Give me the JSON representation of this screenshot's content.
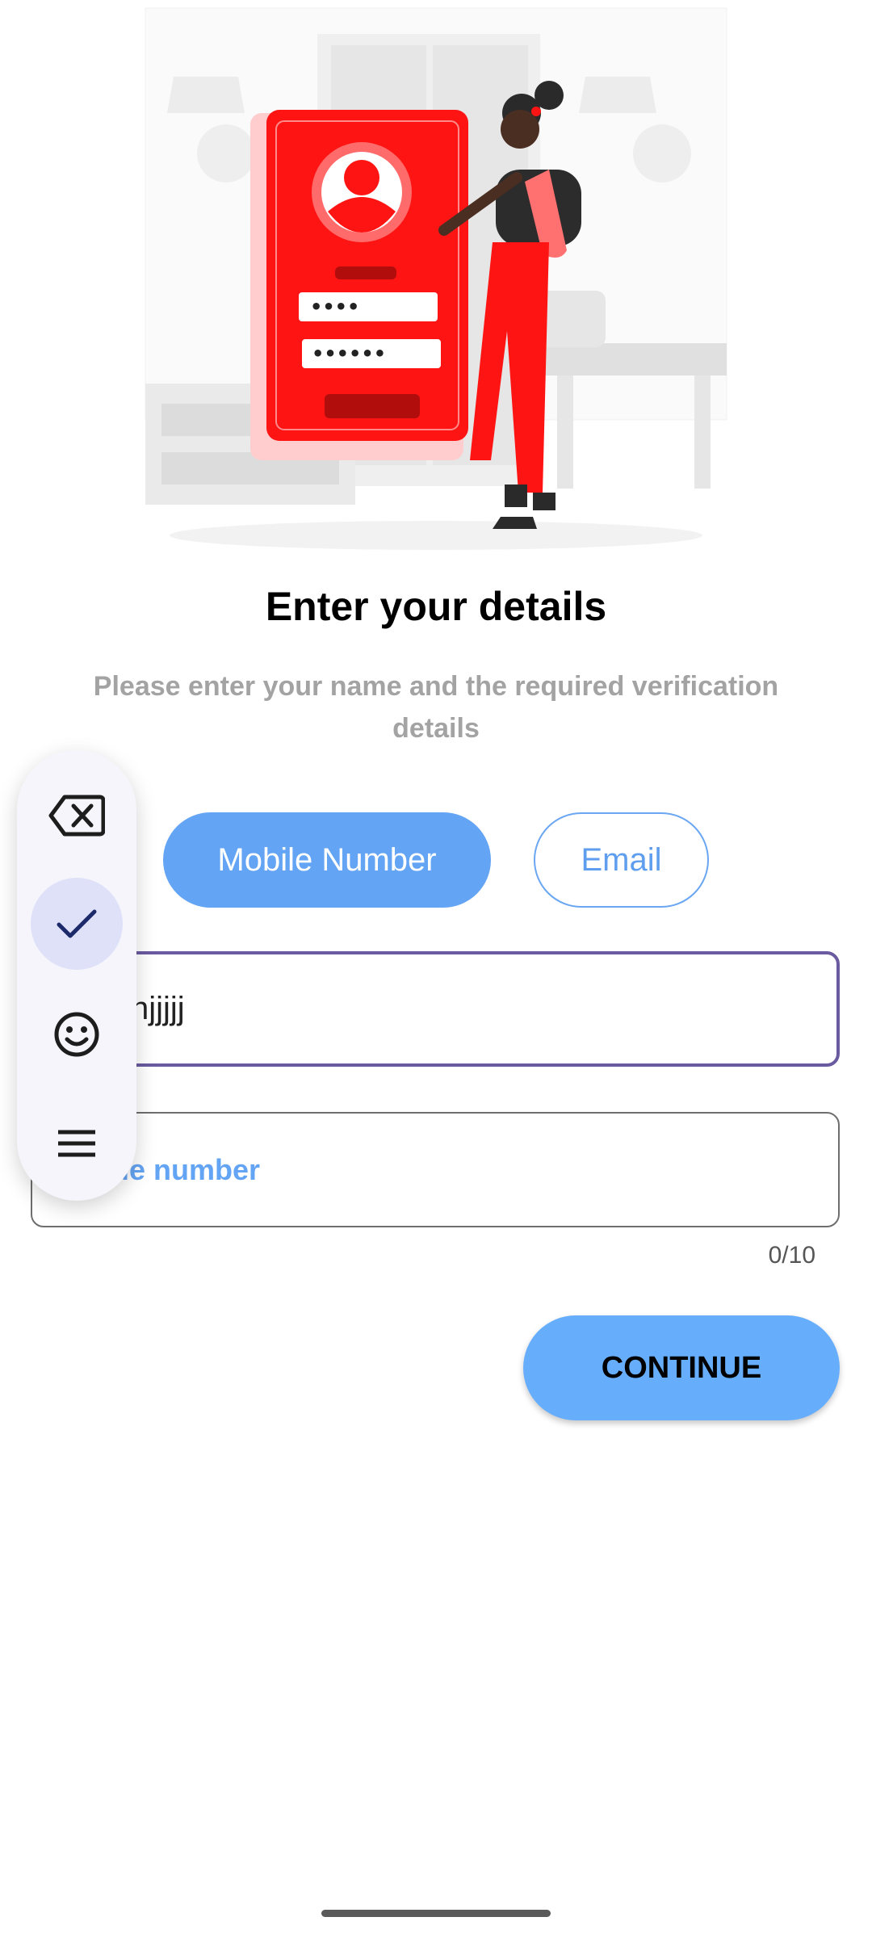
{
  "page": {
    "title": "Enter your details",
    "subtitle": "Please enter your name and the required verification details"
  },
  "toggle": {
    "mobile_label": "Mobile Number",
    "email_label": "Email",
    "selected": "Mobile Number"
  },
  "fields": {
    "name_value": "hjjjjj",
    "mobile_placeholder": "Mobile number",
    "mobile_visible_placeholder": "ile number",
    "mobile_counter": "0/10"
  },
  "actions": {
    "continue_label": "CONTINUE"
  },
  "keyboard_toolbar": {
    "items": [
      "backspace-icon",
      "check-icon",
      "emoji-icon",
      "menu-icon"
    ],
    "selected": "check-icon"
  },
  "illustration": {
    "password_dots_short": "••••",
    "password_dots_long": "••••••"
  },
  "colors": {
    "accent": "#64a4f4",
    "focus_border": "#6a5aa0",
    "illustration_red": "#ff1414"
  }
}
